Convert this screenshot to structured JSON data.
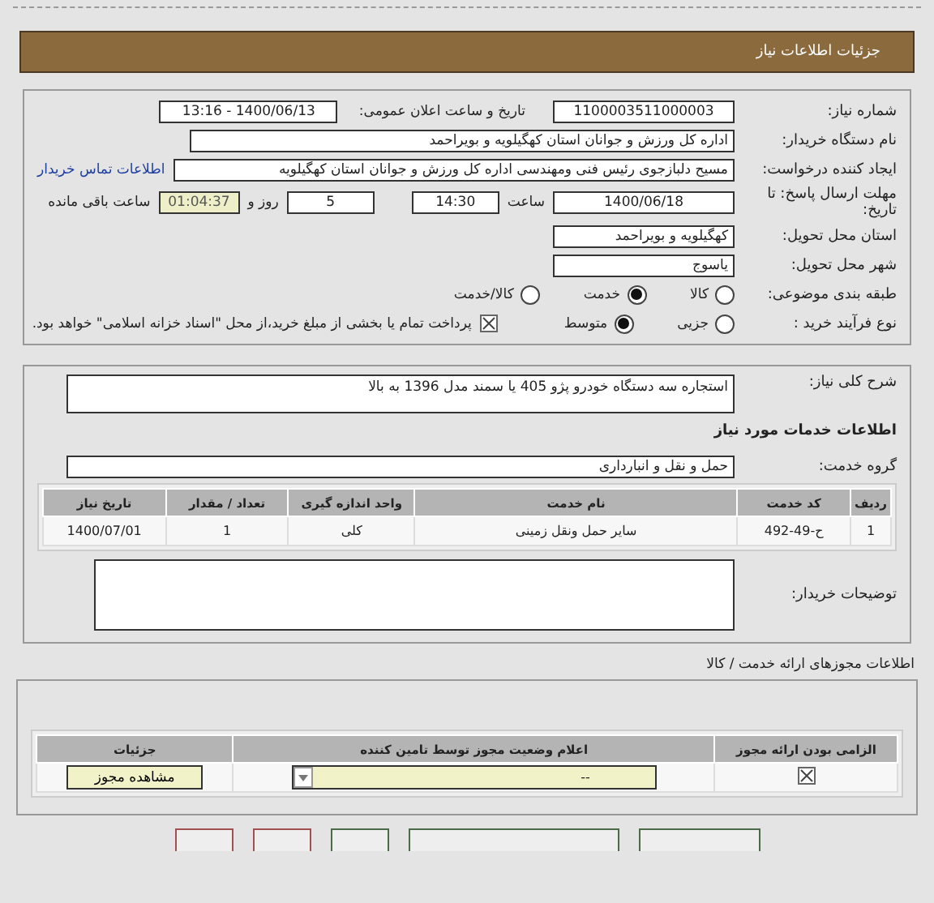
{
  "header": {
    "title": "جزئیات اطلاعات نیاز"
  },
  "need_info": {
    "need_number": {
      "label": "شماره نیاز:",
      "value": "1100003511000003"
    },
    "announce_datetime": {
      "label": "تاریخ و ساعت اعلان عمومی:",
      "value": "1400/06/13 - 13:16"
    },
    "buyer_org": {
      "label": "نام دستگاه خریدار:",
      "value": "اداره کل ورزش و جوانان استان کهگیلویه و بویراحمد"
    },
    "requester": {
      "label": "ایجاد کننده درخواست:",
      "value": "مسیح دلبازجوی رئیس فنی ومهندسی اداره کل ورزش و جوانان استان کهگیلویه",
      "link": "اطلاعات تماس خریدار"
    },
    "deadline": {
      "label": "مهلت ارسال پاسخ: تا تاریخ:",
      "date": "1400/06/18",
      "time_label": "ساعت",
      "time": "14:30",
      "days": "5",
      "days_label": "روز و",
      "remaining": "01:04:37",
      "remaining_label": "ساعت باقی مانده"
    },
    "province": {
      "label": "استان محل تحویل:",
      "value": "کهگیلویه و بویراحمد"
    },
    "city": {
      "label": "شهر محل تحویل:",
      "value": "یاسوج"
    },
    "category": {
      "label": "طبقه بندی موضوعی:",
      "options": [
        {
          "label": "کالا",
          "selected": false
        },
        {
          "label": "خدمت",
          "selected": true
        },
        {
          "label": "کالا/خدمت",
          "selected": false
        }
      ]
    },
    "purchase_type": {
      "label": "نوع فرآیند خرید :",
      "options": [
        {
          "label": "جزیی",
          "selected": false
        },
        {
          "label": "متوسط",
          "selected": true
        }
      ],
      "payment_note": {
        "checked": true,
        "text": "پرداخت تمام یا بخشی از مبلغ خرید،از محل \"اسناد خزانه اسلامی\" خواهد بود."
      }
    }
  },
  "services": {
    "description": {
      "label": "شرح کلی نیاز:",
      "value": "استجاره سه دستگاه خودرو پژو 405 یا سمند مدل 1396 به بالا"
    },
    "section_title": "اطلاعات خدمات مورد نیاز",
    "group": {
      "label": "گروه خدمت:",
      "value": "حمل و نقل و انبارداری"
    },
    "table": {
      "columns": [
        "ردیف",
        "کد خدمت",
        "نام خدمت",
        "واحد اندازه گیری",
        "تعداد / مقدار",
        "تاریخ نیاز"
      ],
      "rows": [
        [
          "1",
          "ح-49-492",
          "سایر حمل ونقل زمینی",
          "کلی",
          "1",
          "1400/07/01"
        ]
      ]
    },
    "buyer_notes": {
      "label": "توضیحات خریدار:"
    }
  },
  "permits": {
    "section_title": "اطلاعات مجوزهای ارائه خدمت / کالا",
    "table": {
      "columns": [
        "الزامی بودن ارائه مجوز",
        "اعلام وضعیت مجوز توسط تامین کننده",
        "جزئیات"
      ],
      "rows": [
        {
          "required": true,
          "status": "--",
          "details_button": "مشاهده مجوز"
        }
      ]
    }
  },
  "footer_buttons": [
    {
      "color": "#a05050"
    },
    {
      "color": "#a05050"
    },
    {
      "color": "#4a6a4a"
    },
    {
      "color": "#4a6a4a"
    },
    {
      "color": "#4a6a4a"
    }
  ]
}
